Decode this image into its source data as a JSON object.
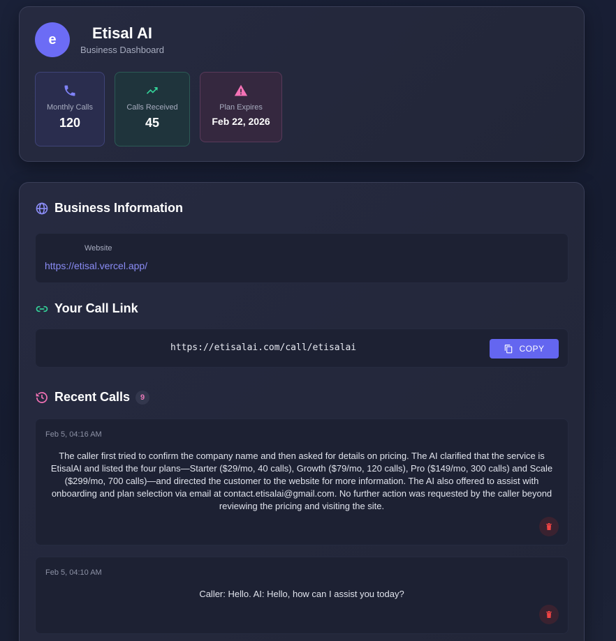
{
  "header": {
    "avatar_letter": "e",
    "business_name": "Etisal AI",
    "subtitle": "Business Dashboard",
    "stats": [
      {
        "label": "Monthly Calls",
        "value": "120",
        "icon": "phone-icon"
      },
      {
        "label": "Calls Received",
        "value": "45",
        "icon": "trending-up-icon"
      },
      {
        "label": "Plan Expires",
        "value": "Feb 22, 2026",
        "icon": "warning-icon"
      }
    ]
  },
  "business_info": {
    "title": "Business Information",
    "website_label": "Website",
    "website_url": "https://etisal.vercel.app/"
  },
  "call_link": {
    "title": "Your Call Link",
    "url": "https://etisalai.com/call/etisalai",
    "copy_label": "COPY"
  },
  "recent_calls": {
    "title": "Recent Calls",
    "count": "9",
    "items": [
      {
        "time": "Feb 5, 04:16 AM",
        "summary": "The caller first tried to confirm the company name and then asked for details on pricing. The AI clarified that the service is EtisalAI and listed the four plans—Starter ($29/mo, 40 calls), Growth ($79/mo, 120 calls), Pro ($149/mo, 300 calls) and Scale ($299/mo, 700 calls)—and directed the customer to the website for more information. The AI also offered to assist with onboarding and plan selection via email at contact.etisalai@gmail.com. No further action was requested by the caller beyond reviewing the pricing and visiting the site."
      },
      {
        "time": "Feb 5, 04:10 AM",
        "summary": "Caller: Hello. AI: Hello, how can I assist you today?"
      }
    ]
  },
  "colors": {
    "accent": "#6466f0",
    "green": "#34d399",
    "pink": "#f472b6"
  }
}
